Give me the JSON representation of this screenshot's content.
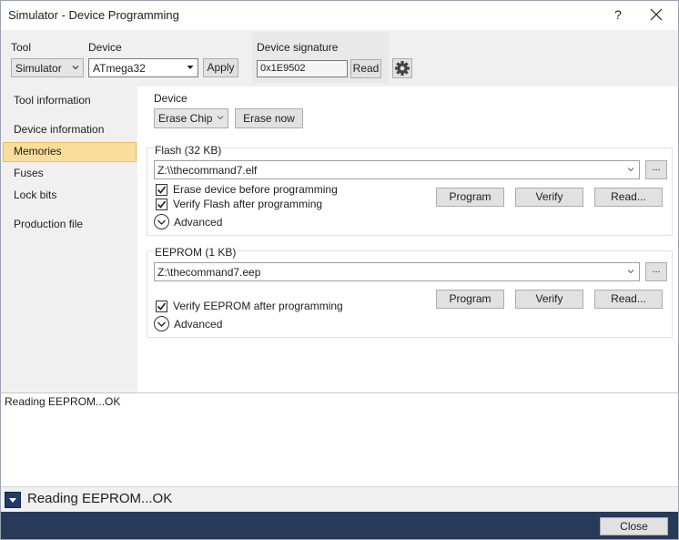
{
  "window": {
    "title": "Simulator - Device Programming",
    "help_label": "?"
  },
  "topbar": {
    "tool_label": "Tool",
    "tool_value": "Simulator",
    "device_label": "Device",
    "device_value": "ATmega32",
    "apply_label": "Apply",
    "signature_label": "Device signature",
    "signature_value": "0x1E9502",
    "read_label": "Read"
  },
  "sidebar": {
    "items": [
      {
        "label": "Tool information"
      },
      {
        "label": "Device information"
      },
      {
        "label": "Memories"
      },
      {
        "label": "Fuses"
      },
      {
        "label": "Lock bits"
      },
      {
        "label": "Production file"
      }
    ],
    "active": "Memories"
  },
  "device_group": {
    "title": "Device",
    "erase_combo": "Erase Chip",
    "erase_now": "Erase now"
  },
  "flash_group": {
    "title": "Flash (32 KB)",
    "path": "Z:\\\\thecommand7.elf",
    "browse": "...",
    "erase_before": "Erase device before programming",
    "verify_after": "Verify Flash after programming",
    "program": "Program",
    "verify": "Verify",
    "read": "Read...",
    "advanced": "Advanced"
  },
  "eeprom_group": {
    "title": "EEPROM (1 KB)",
    "path": "Z:\\thecommand7.eep",
    "browse": "...",
    "verify_after": "Verify EEPROM after programming",
    "program": "Program",
    "verify": "Verify",
    "read": "Read...",
    "advanced": "Advanced"
  },
  "log": {
    "lines": [
      "Reading EEPROM...OK"
    ]
  },
  "status": {
    "text": "Reading EEPROM...OK"
  },
  "footer": {
    "close_label": "Close"
  },
  "colors": {
    "nav_active_bg": "#f8de9a",
    "footer_bg": "#283a5a",
    "expand_btn_bg": "#1f3b68"
  }
}
